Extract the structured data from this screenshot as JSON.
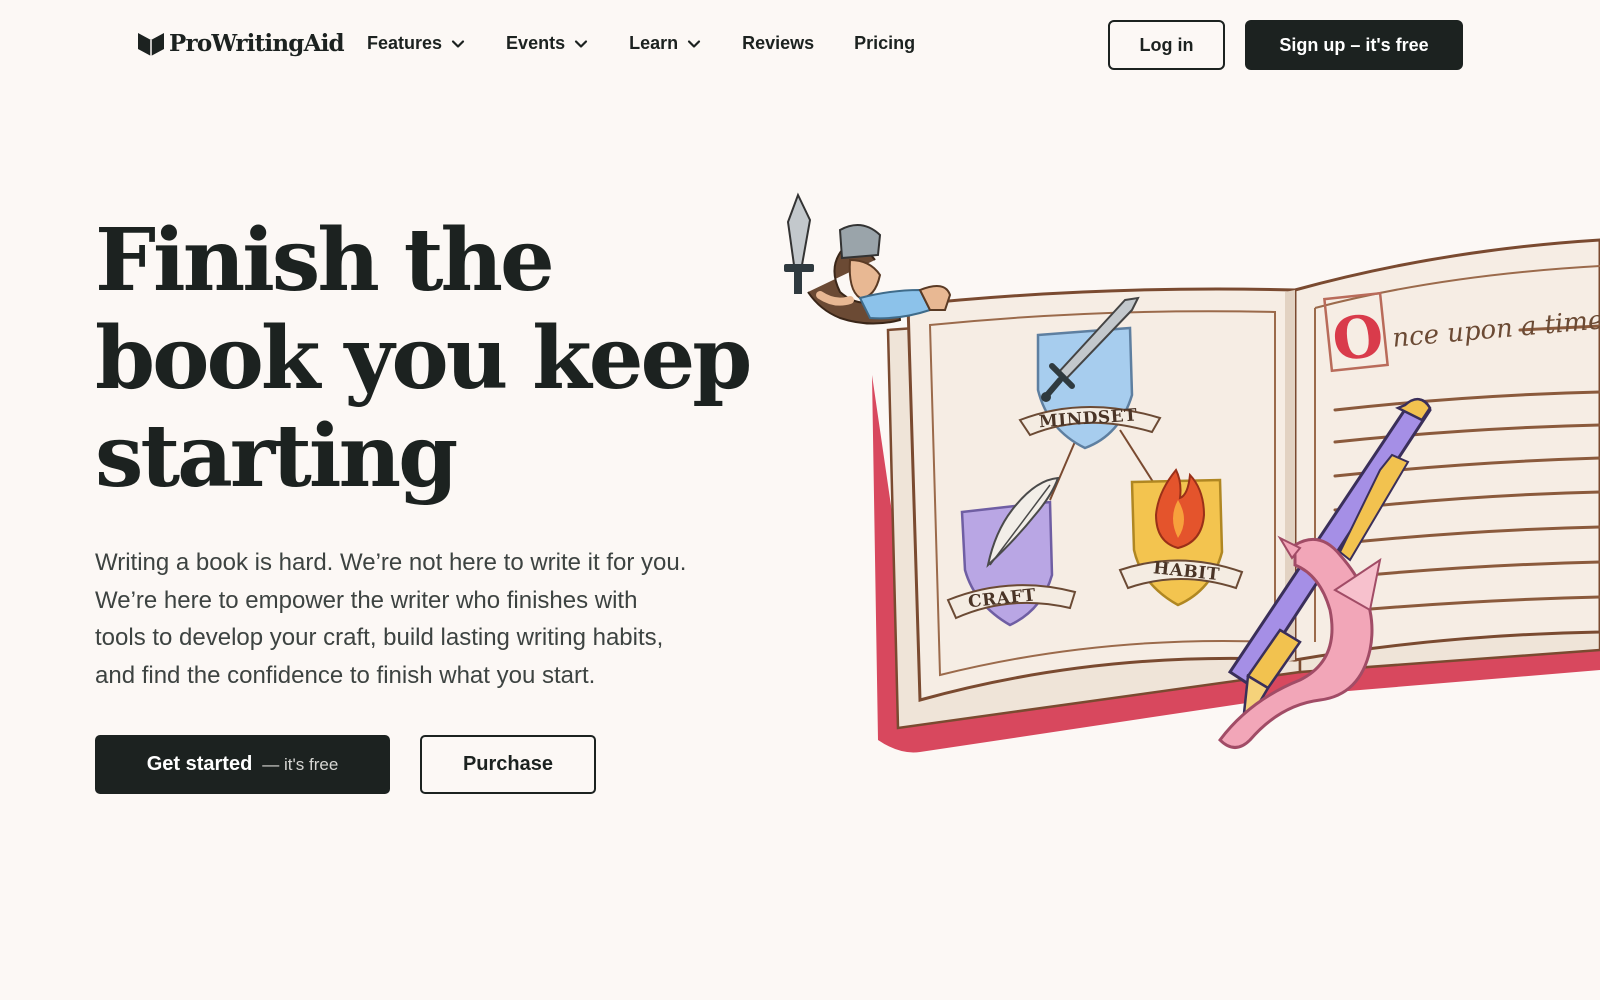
{
  "brand": {
    "name": "ProWritingAid"
  },
  "nav": {
    "items": [
      {
        "label": "Features",
        "has_dropdown": true
      },
      {
        "label": "Events",
        "has_dropdown": true
      },
      {
        "label": "Learn",
        "has_dropdown": true
      },
      {
        "label": "Reviews",
        "has_dropdown": false
      },
      {
        "label": "Pricing",
        "has_dropdown": false
      }
    ],
    "login_label": "Log in",
    "signup_label": "Sign up – it's free"
  },
  "hero": {
    "headline_lines": [
      "Finish the",
      "book you keep",
      "starting"
    ],
    "subtext_lines": [
      "Writing a book is hard. We’re not here to write it for you.",
      "We’re here to empower the writer who finishes with",
      "tools to develop your craft, build lasting writing habits,",
      "and find the confidence to finish what you start."
    ],
    "cta_primary_label": "Get started",
    "cta_primary_suffix": "— it's free",
    "cta_secondary_label": "Purchase"
  },
  "illustration": {
    "crests": [
      "MINDSET",
      "CRAFT",
      "HABIT"
    ],
    "page_heading_dropcap": "O",
    "page_heading_rest": "nce upon a time",
    "icons": [
      "knight-icon",
      "sword-icon",
      "quill-icon",
      "flame-icon",
      "fountain-pen-icon",
      "dragon-icon",
      "open-book-icon"
    ]
  },
  "colors": {
    "background": "#fcf8f5",
    "ink": "#1c2220",
    "book_cover": "#d8485e",
    "pen_body": "#a58fe6",
    "pen_gold": "#f2c24f"
  }
}
